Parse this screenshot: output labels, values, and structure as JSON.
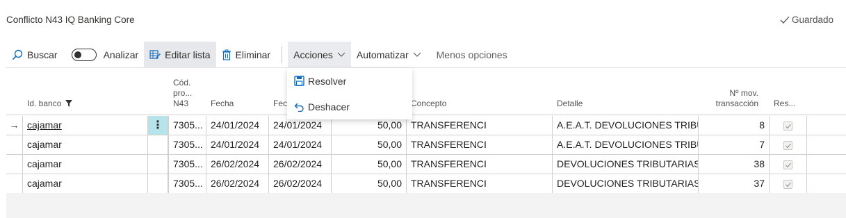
{
  "header": {
    "title": "Conflicto N43 IQ Banking Core",
    "saved_label": "Guardado"
  },
  "toolbar": {
    "search_label": "Buscar",
    "analyze_label": "Analizar",
    "edit_list_label": "Editar lista",
    "delete_label": "Eliminar",
    "actions_label": "Acciones",
    "automate_label": "Automatizar",
    "less_options_label": "Menos opciones"
  },
  "actions_menu": {
    "resolve_label": "Resolver",
    "undo_label": "Deshacer"
  },
  "grid": {
    "columns": {
      "bank_id": "Id. banco",
      "cod_line1": "Cód.",
      "cod_line2": "pro...",
      "cod_line3": "N43",
      "fecha": "Fecha",
      "fecha2": "Fecha",
      "concepto": "Concepto",
      "detalle": "Detalle",
      "mov_line1": "Nº mov.",
      "mov_line2": "transacción",
      "res": "Res..."
    },
    "rows": [
      {
        "bank": "cajamar",
        "cod": "7305...",
        "fecha": "24/01/2024",
        "fecha2": "24/01/2024",
        "importe": "50,00",
        "concepto": "TRANSFERENCI",
        "detalle": "A.E.A.T. DEVOLUCIONES TRIBU...",
        "mov": "8",
        "selected": true
      },
      {
        "bank": "cajamar",
        "cod": "7305...",
        "fecha": "24/01/2024",
        "fecha2": "24/01/2024",
        "importe": "50,00",
        "concepto": "TRANSFERENCI",
        "detalle": "A.E.A.T. DEVOLUCIONES TRIBU...",
        "mov": "7"
      },
      {
        "bank": "cajamar",
        "cod": "7305...",
        "fecha": "26/02/2024",
        "fecha2": "26/02/2024",
        "importe": "50,00",
        "concepto": "TRANSFERENCI",
        "detalle": "DEVOLUCIONES TRIBUTARIAS,...",
        "mov": "38"
      },
      {
        "bank": "cajamar",
        "cod": "7305...",
        "fecha": "26/02/2024",
        "fecha2": "26/02/2024",
        "importe": "50,00",
        "concepto": "TRANSFERENCI",
        "detalle": "DEVOLUCIONES TRIBUTARIAS,...",
        "mov": "37"
      }
    ]
  },
  "colors": {
    "accent": "#0f7b8c",
    "selected_cell": "#b7e4ea"
  }
}
